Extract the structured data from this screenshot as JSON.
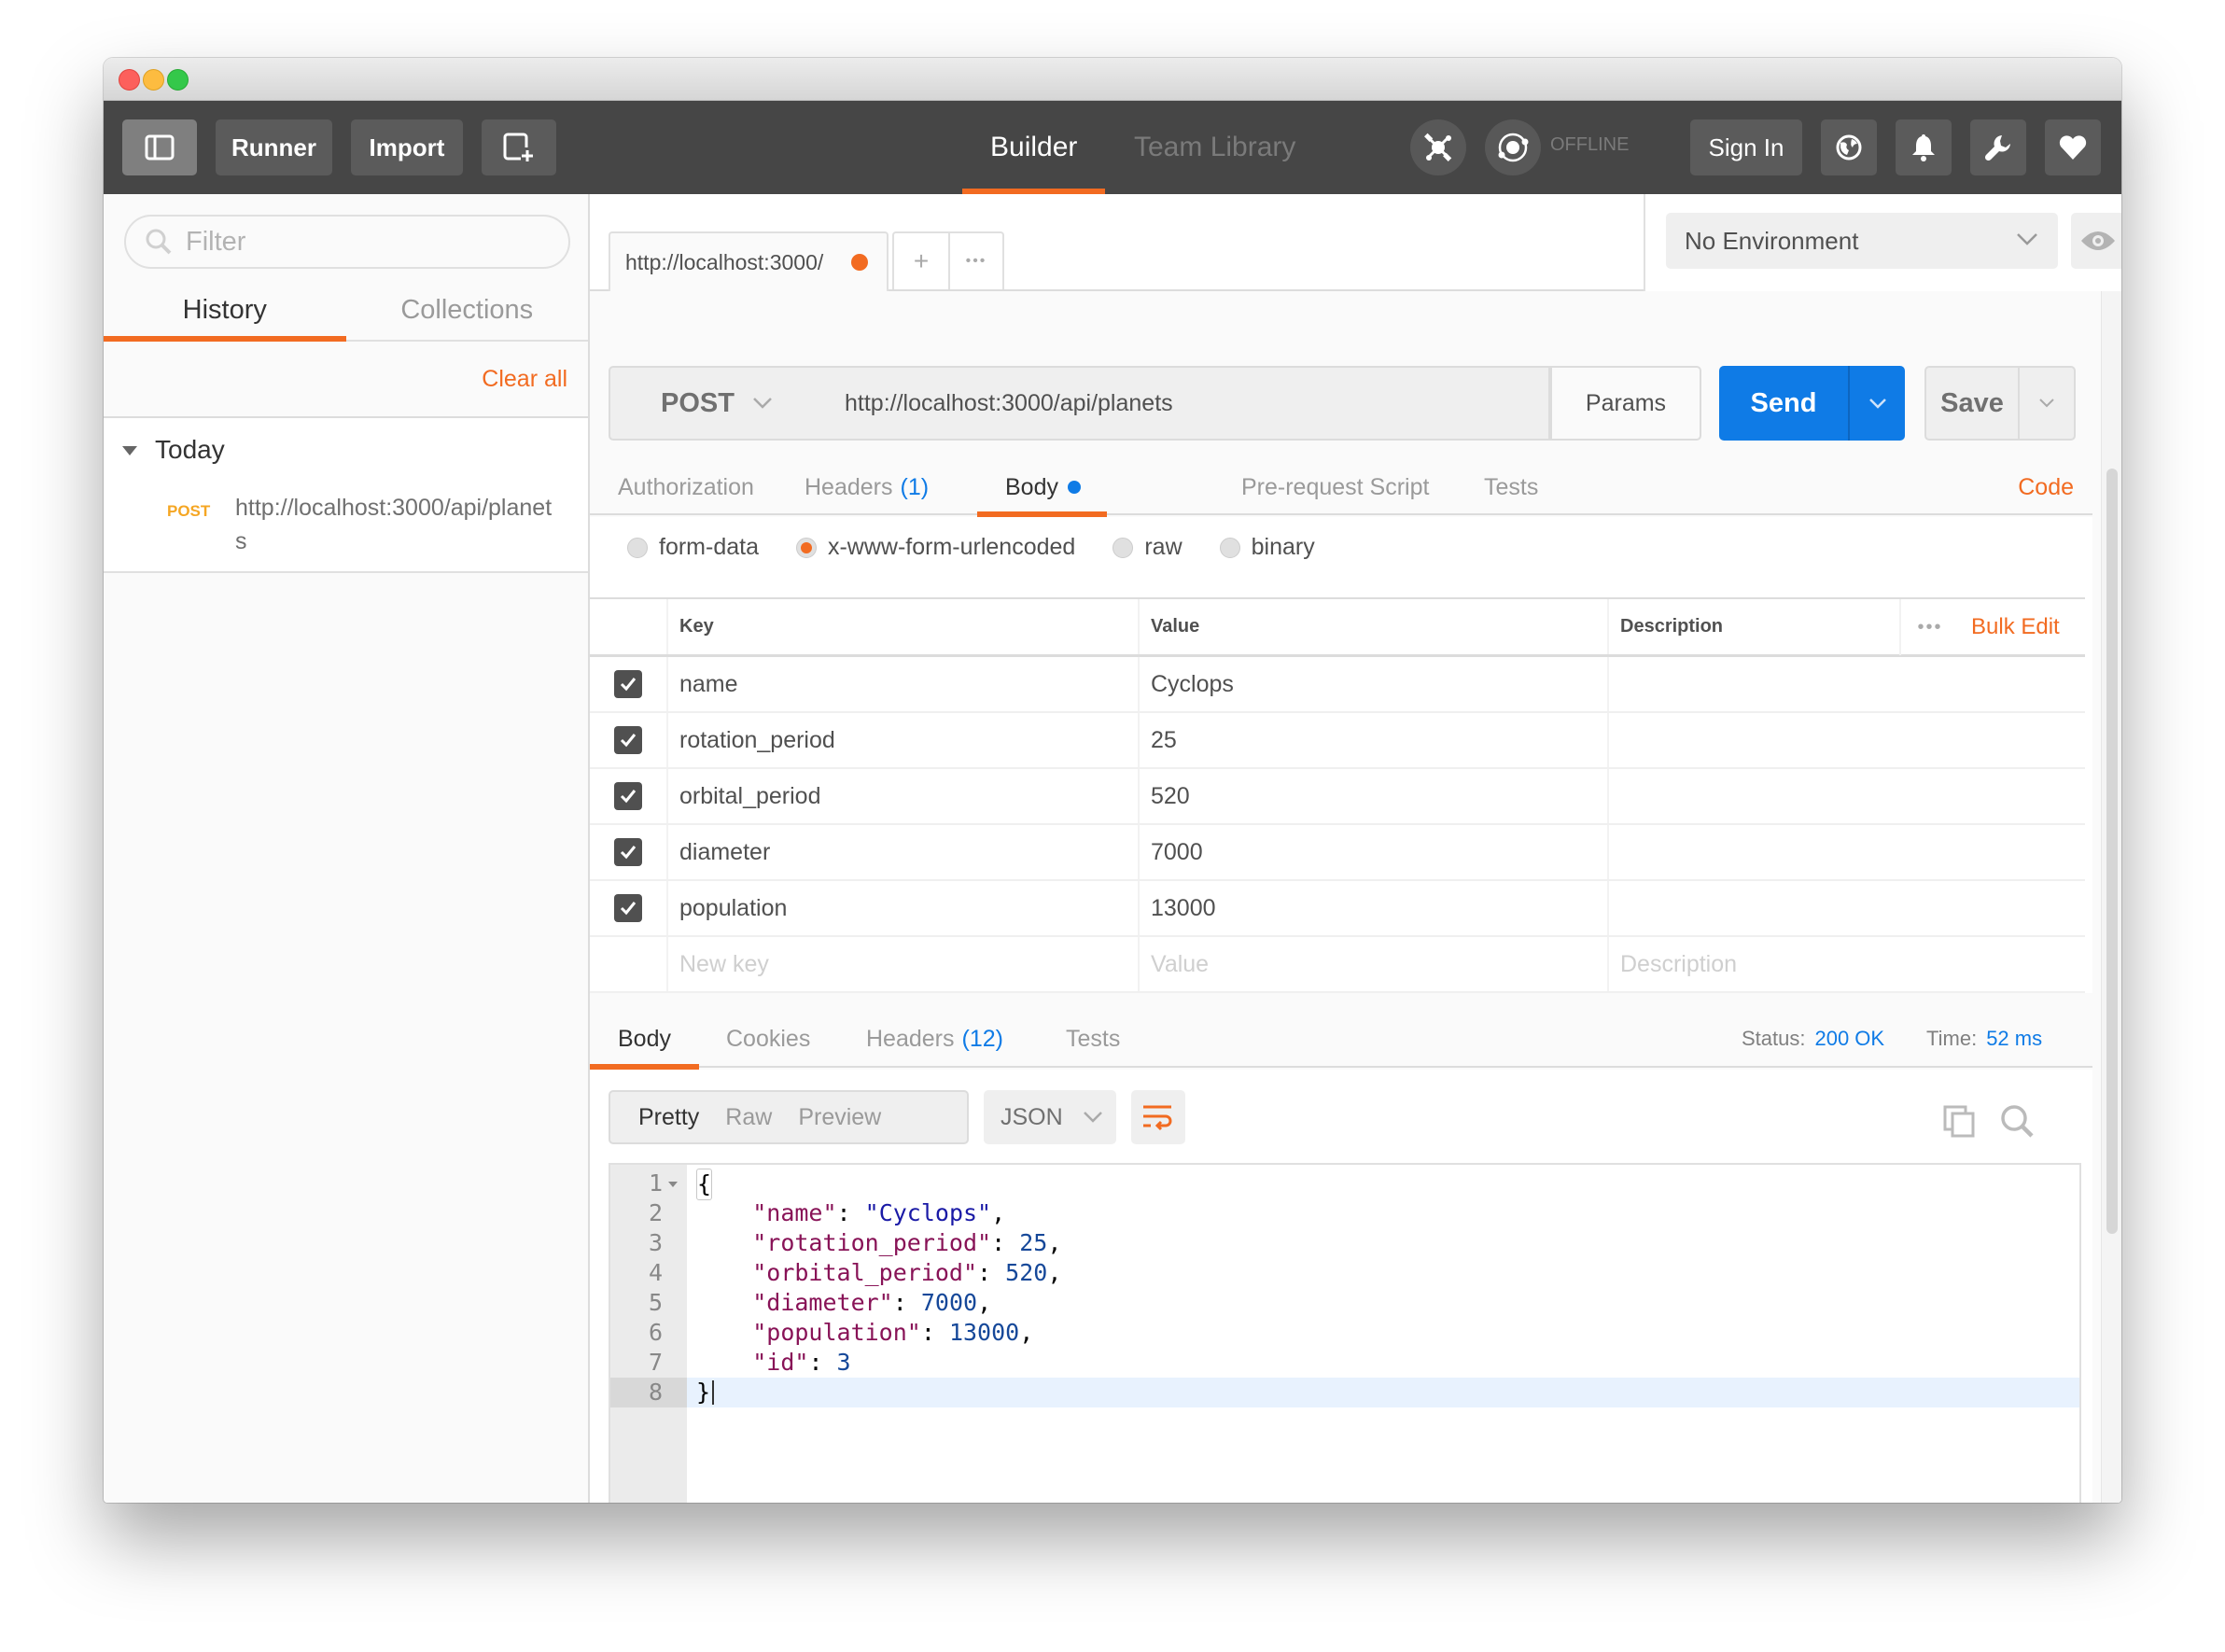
{
  "toolbar": {
    "runner_label": "Runner",
    "import_label": "Import",
    "tabs": [
      {
        "label": "Builder",
        "active": true
      },
      {
        "label": "Team Library",
        "active": false
      }
    ],
    "sync_status": "OFFLINE",
    "sign_in_label": "Sign In",
    "icons": [
      "sidebar-toggle-icon",
      "new-window-icon",
      "interceptor-icon",
      "sync-icon",
      "globe-icon",
      "bell-icon",
      "wrench-icon",
      "heart-icon"
    ]
  },
  "sidebar": {
    "filter_placeholder": "Filter",
    "tabs": [
      {
        "label": "History",
        "active": true
      },
      {
        "label": "Collections",
        "active": false
      }
    ],
    "clear_all_label": "Clear all",
    "groups": [
      {
        "label": "Today",
        "items": [
          {
            "method": "POST",
            "url": "http://localhost:3000/api/planets"
          }
        ]
      }
    ]
  },
  "request_tabs": {
    "active_tab_label": "http://localhost:3000/",
    "add_label": "+",
    "more_label": "•••"
  },
  "environment": {
    "selected": "No Environment"
  },
  "request": {
    "method": "POST",
    "url": "http://localhost:3000/api/planets",
    "params_label": "Params",
    "send_label": "Send",
    "save_label": "Save",
    "tabs": [
      {
        "label": "Authorization",
        "count": null,
        "active": false
      },
      {
        "label": "Headers",
        "count": "(1)",
        "active": false
      },
      {
        "label": "Body",
        "count": null,
        "active": true
      },
      {
        "label": "Pre-request Script",
        "count": null,
        "active": false
      },
      {
        "label": "Tests",
        "count": null,
        "active": false
      }
    ],
    "code_label": "Code",
    "body_types": [
      {
        "label": "form-data",
        "selected": false
      },
      {
        "label": "x-www-form-urlencoded",
        "selected": true
      },
      {
        "label": "raw",
        "selected": false
      },
      {
        "label": "binary",
        "selected": false
      }
    ],
    "table": {
      "headers": {
        "key": "Key",
        "value": "Value",
        "description": "Description"
      },
      "more_label": "•••",
      "bulk_edit_label": "Bulk Edit",
      "rows": [
        {
          "checked": true,
          "key": "name",
          "value": "Cyclops",
          "description": ""
        },
        {
          "checked": true,
          "key": "rotation_period",
          "value": "25",
          "description": ""
        },
        {
          "checked": true,
          "key": "orbital_period",
          "value": "520",
          "description": ""
        },
        {
          "checked": true,
          "key": "diameter",
          "value": "7000",
          "description": ""
        },
        {
          "checked": true,
          "key": "population",
          "value": "13000",
          "description": ""
        }
      ],
      "placeholders": {
        "key": "New key",
        "value": "Value",
        "description": "Description"
      }
    }
  },
  "response": {
    "tabs": [
      {
        "label": "Body",
        "count": null,
        "active": true
      },
      {
        "label": "Cookies",
        "count": null,
        "active": false
      },
      {
        "label": "Headers",
        "count": "(12)",
        "active": false
      },
      {
        "label": "Tests",
        "count": null,
        "active": false
      }
    ],
    "status_label": "Status:",
    "status_value": "200 OK",
    "time_label": "Time:",
    "time_value": "52 ms",
    "view_modes": [
      "Pretty",
      "Raw",
      "Preview"
    ],
    "active_view": "Pretty",
    "format": "JSON",
    "code_lines": [
      {
        "n": "1",
        "text": "{"
      },
      {
        "n": "2",
        "key": "\"name\"",
        "value": "\"Cyclops\"",
        "value_type": "string",
        "comma": ","
      },
      {
        "n": "3",
        "key": "\"rotation_period\"",
        "value": "25",
        "value_type": "number",
        "comma": ","
      },
      {
        "n": "4",
        "key": "\"orbital_period\"",
        "value": "520",
        "value_type": "number",
        "comma": ","
      },
      {
        "n": "5",
        "key": "\"diameter\"",
        "value": "7000",
        "value_type": "number",
        "comma": ","
      },
      {
        "n": "6",
        "key": "\"population\"",
        "value": "13000",
        "value_type": "number",
        "comma": ","
      },
      {
        "n": "7",
        "key": "\"id\"",
        "value": "3",
        "value_type": "number",
        "comma": ""
      },
      {
        "n": "8",
        "text": "}"
      }
    ]
  },
  "colors": {
    "accent": "#f26b21",
    "primary": "#0f7be6",
    "toolbar_bg": "#464646",
    "method_post": "#f5a623"
  }
}
